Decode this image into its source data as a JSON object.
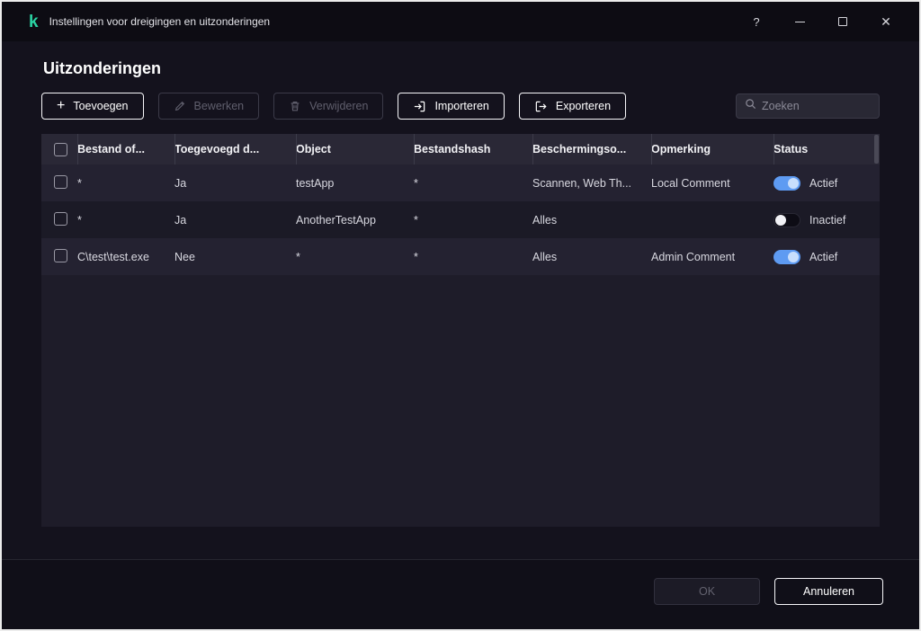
{
  "window": {
    "title": "Instellingen voor dreigingen en uitzonderingen",
    "icons": {
      "logo": "k",
      "help": "?",
      "close": "✕",
      "add": "+"
    }
  },
  "page": {
    "title": "Uitzonderingen"
  },
  "toolbar": {
    "add": "Toevoegen",
    "edit": "Bewerken",
    "delete": "Verwijderen",
    "import": "Importeren",
    "export": "Exporteren",
    "search_placeholder": "Zoeken"
  },
  "table": {
    "columns": [
      "Bestand of...",
      "Toegevoegd d...",
      "Object",
      "Bestandshash",
      "Beschermingso...",
      "Opmerking",
      "Status"
    ],
    "rows": [
      {
        "file": "*",
        "added": "Ja",
        "object": "testApp",
        "hash": "*",
        "protection": "Scannen, Web Th...",
        "comment": "Local Comment",
        "status": "Actief",
        "active": true
      },
      {
        "file": "*",
        "added": "Ja",
        "object": "AnotherTestApp",
        "hash": "*",
        "protection": "Alles",
        "comment": "",
        "status": "Inactief",
        "active": false
      },
      {
        "file": "C\\test\\test.exe",
        "added": "Nee",
        "object": "*",
        "hash": "*",
        "protection": "Alles",
        "comment": "Admin Comment",
        "status": "Actief",
        "active": true
      }
    ]
  },
  "footer": {
    "ok": "OK",
    "cancel": "Annuleren"
  },
  "colors": {
    "accent_green": "#2bd3a3",
    "toggle_on": "#5e9bf2"
  }
}
